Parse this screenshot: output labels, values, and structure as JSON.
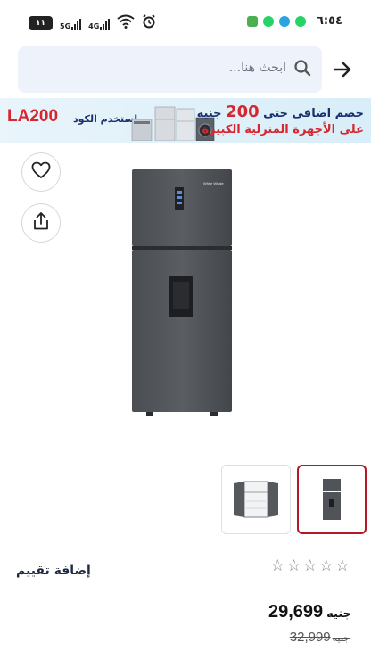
{
  "status_bar": {
    "time": "٦:٥٤",
    "battery": "١١",
    "network_1": "5G",
    "network_2": "4G",
    "icons": [
      "alarm-icon",
      "wifi-icon",
      "whatsapp-icon",
      "telegram-icon",
      "whatsapp-icon",
      "messages-icon"
    ]
  },
  "header": {
    "search_placeholder": "ابحث هنا...",
    "search_icon": "search-icon",
    "back_icon": "arrow-right-icon"
  },
  "banner": {
    "code": "LA200",
    "code_prefix": "استخدم الكود",
    "line1_before": "خصم اضافى حتى",
    "line1_amount": "200",
    "line1_after": "جنيه",
    "line2": "على الأجهزة المنزلية الكبيرة"
  },
  "actions": {
    "wishlist_icon": "heart-icon",
    "share_icon": "share-icon"
  },
  "product": {
    "brand_mark": "White Whale",
    "thumbnails": [
      "refrigerator-closed",
      "refrigerator-open"
    ],
    "selected_thumbnail": 0
  },
  "rating": {
    "add_review": "إضافة تقييم",
    "stars_filled": 0,
    "stars_total": 5
  },
  "price": {
    "current": "29,699",
    "current_currency": "جنيه",
    "old": "32,999",
    "old_currency": "جنيه"
  },
  "colors": {
    "accent_red": "#d6262f",
    "navy": "#1a2f6e",
    "thumb_selected_border": "#b11a24",
    "search_bg": "#eef2fa"
  }
}
